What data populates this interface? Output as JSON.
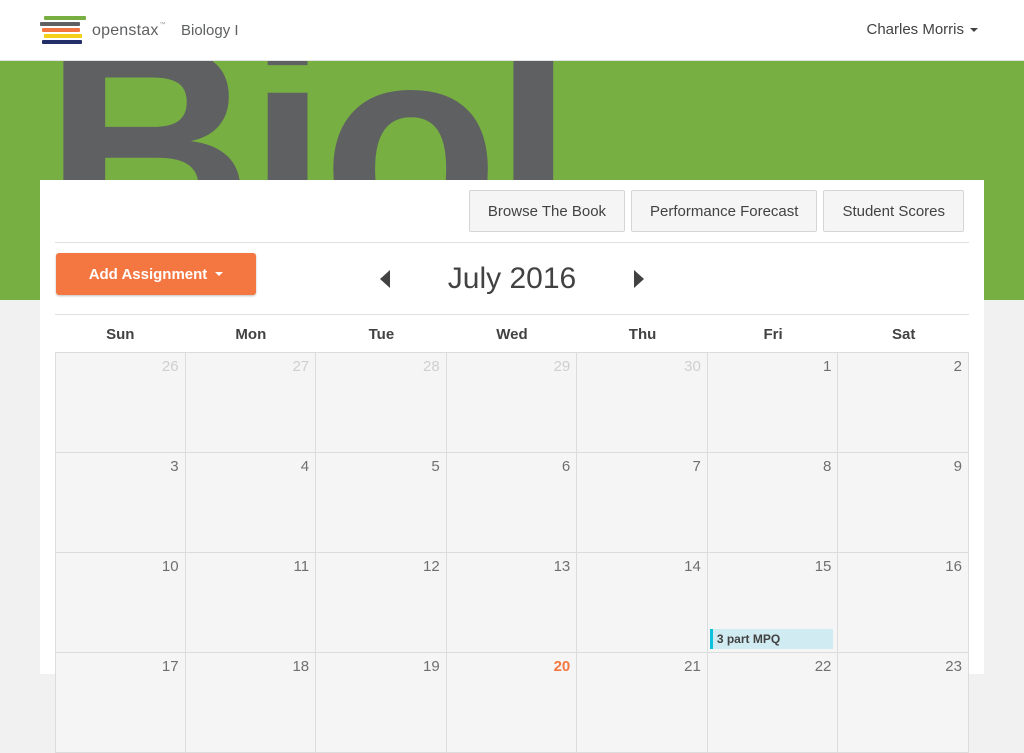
{
  "header": {
    "brand": "openstax",
    "trademark": "™",
    "course_title": "Biology I",
    "user_name": "Charles Morris"
  },
  "banner": {
    "word": "Biol",
    "background_color": "#77af42"
  },
  "toolbar": {
    "browse_book": "Browse The Book",
    "performance_forecast": "Performance Forecast",
    "student_scores": "Student Scores",
    "add_assignment": "Add Assignment"
  },
  "calendar": {
    "month_label": "July 2016",
    "weekdays": [
      "Sun",
      "Mon",
      "Tue",
      "Wed",
      "Thu",
      "Fri",
      "Sat"
    ],
    "today": "20",
    "weeks": [
      [
        "26",
        "27",
        "28",
        "29",
        "30",
        "1",
        "2"
      ],
      [
        "3",
        "4",
        "5",
        "6",
        "7",
        "8",
        "9"
      ],
      [
        "10",
        "11",
        "12",
        "13",
        "14",
        "15",
        "16"
      ],
      [
        "17",
        "18",
        "19",
        "20",
        "21",
        "22",
        "23"
      ]
    ],
    "other_month_days_in_first_week": 5,
    "events": [
      {
        "week": 2,
        "day": 5,
        "label": "3 part MPQ",
        "color": "#0dc0dc"
      }
    ]
  },
  "colors": {
    "accent_orange": "#f47641",
    "event_blue": "#0dc0dc",
    "logo_bars": [
      "#77af42",
      "#5e6062",
      "#f47641",
      "#f4d019",
      "#232e66"
    ]
  }
}
